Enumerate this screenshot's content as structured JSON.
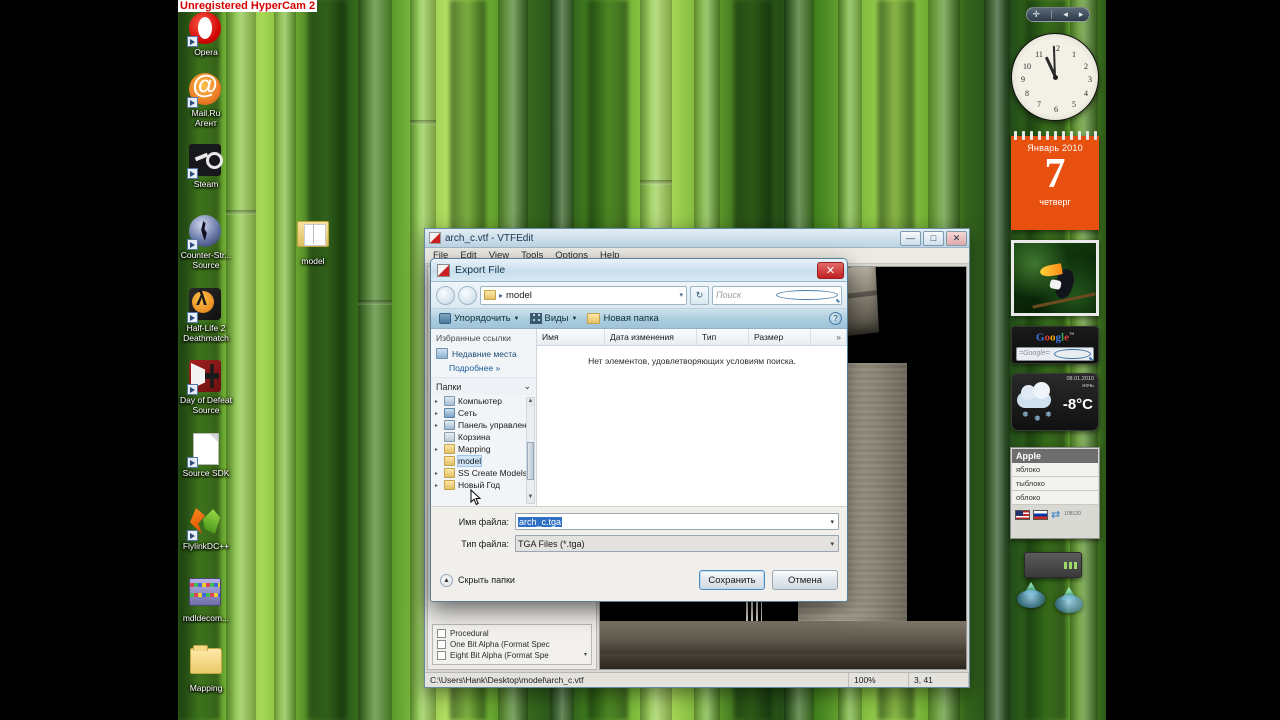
{
  "watermark": {
    "text": "Unregistered HyperCam 2"
  },
  "desktop": {
    "icons": [
      {
        "label": "Opera",
        "icon": "opera-icon"
      },
      {
        "label": "Mail.Ru\nАгент",
        "icon": "mailru-agent-icon"
      },
      {
        "label": "Steam",
        "icon": "steam-icon"
      },
      {
        "label": "Counter-Str...\nSource",
        "icon": "counter-strike-source-icon"
      },
      {
        "label": "Half-Life 2\nDeathmatch",
        "icon": "half-life-2-deathmatch-icon"
      },
      {
        "label": "Day of Defeat\nSource",
        "icon": "day-of-defeat-source-icon"
      },
      {
        "label": "Source SDK",
        "icon": "source-sdk-icon"
      },
      {
        "label": "FlylinkDC++",
        "icon": "flylinkdc-icon"
      },
      {
        "label": "mdldecom...",
        "icon": "winrar-archive-icon"
      },
      {
        "label": "Mapping",
        "icon": "folder-icon"
      },
      {
        "label": "model",
        "icon": "folder-open-icon"
      }
    ]
  },
  "sidebar": {
    "clock": {
      "numbers": [
        "12",
        "1",
        "2",
        "3",
        "4",
        "5",
        "6",
        "7",
        "8",
        "9",
        "10",
        "11"
      ]
    },
    "calendar": {
      "month": "Январь 2010",
      "day": "7",
      "weekday": "четверг"
    },
    "google": {
      "logo_letters": [
        "G",
        "o",
        "o",
        "g",
        "l",
        "e"
      ],
      "trademark": "™",
      "placeholder": "=Google="
    },
    "weather": {
      "date": "08.01.2010",
      "period": "ночь",
      "temperature": "-8°C"
    },
    "dictionary": {
      "word": "Apple",
      "translations": [
        "яблоко",
        "тыблоко",
        "облоко"
      ],
      "counter": "108120"
    }
  },
  "vtfedit": {
    "title": "arch_c.vtf - VTFEdit",
    "menu": [
      "File",
      "Edit",
      "View",
      "Tools",
      "Options",
      "Help"
    ],
    "window_buttons": {
      "minimize": "—",
      "maximize": "□",
      "close": "✕"
    },
    "options": [
      {
        "label": "Procedural",
        "checked": false
      },
      {
        "label": "One Bit Alpha (Format Spec",
        "checked": false
      },
      {
        "label": "Eight Bit Alpha (Format Spe",
        "checked": false
      }
    ],
    "statusbar": {
      "path": "C:\\Users\\Hank\\Desktop\\model\\arch_c.vtf",
      "zoom": "100%",
      "coords": "3, 41"
    }
  },
  "dialog": {
    "title": "Export File",
    "close_label": "✕",
    "breadcrumb": {
      "separator": "▸",
      "current": "model",
      "dropdown": "▾"
    },
    "refresh_label": "↻",
    "search": {
      "placeholder": "Поиск"
    },
    "toolbar": {
      "organize": "Упорядочить",
      "views": "Виды",
      "new_folder": "Новая папка",
      "caret": "▼",
      "help": "?"
    },
    "nav": {
      "favorites_header": "Избранные ссылки",
      "favorites": [
        {
          "label": "Недавние места"
        }
      ],
      "more": "Подробнее  »",
      "folders_header": "Папки",
      "folders_caret": "⌄",
      "tree": [
        {
          "label": "Компьютер",
          "icon": "computer-icon",
          "expandable": true,
          "selected": false
        },
        {
          "label": "Сеть",
          "icon": "network-icon",
          "expandable": true,
          "selected": false
        },
        {
          "label": "Панель управлен",
          "icon": "control-panel-icon",
          "expandable": true,
          "selected": false
        },
        {
          "label": "Корзина",
          "icon": "recycle-bin-icon",
          "expandable": false,
          "selected": false
        },
        {
          "label": "Mapping",
          "icon": "folder-icon",
          "expandable": true,
          "selected": false
        },
        {
          "label": "model",
          "icon": "folder-icon",
          "expandable": false,
          "selected": true
        },
        {
          "label": "SS Create Models",
          "icon": "folder-icon",
          "expandable": true,
          "selected": false
        },
        {
          "label": "Новый Год",
          "icon": "folder-icon",
          "expandable": true,
          "selected": false
        }
      ],
      "scroll": {
        "up": "▲",
        "down": "▼"
      }
    },
    "columns": [
      "Имя",
      "Дата изменения",
      "Тип",
      "Размер",
      "»"
    ],
    "empty_message": "Нет элементов, удовлетворяющих условиям поиска.",
    "filename": {
      "label": "Имя файла:",
      "value": "arch_c.tga",
      "caret": "▾"
    },
    "filetype": {
      "label": "Тип файла:",
      "value": "TGA Files (*.tga)",
      "caret": "▾"
    },
    "hide_folders": {
      "label": "Скрыть папки",
      "icon": "▲"
    },
    "save_button": "Сохранить",
    "cancel_button": "Отмена"
  },
  "colors": {
    "accent_blue": "#2f6fc4",
    "calendar_orange": "#e8500f",
    "watermark_red": "#d40000"
  }
}
